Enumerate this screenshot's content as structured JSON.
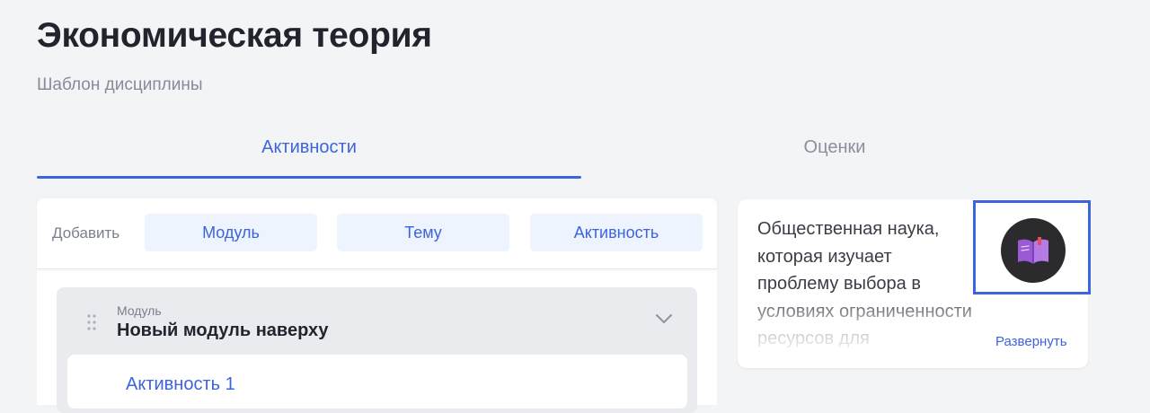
{
  "page": {
    "title": "Экономическая теория",
    "subtitle": "Шаблон дисциплины"
  },
  "tabs": [
    {
      "label": "Активности",
      "active": true
    },
    {
      "label": "Оценки",
      "active": false
    }
  ],
  "add_bar": {
    "label": "Добавить",
    "buttons": [
      "Модуль",
      "Тему",
      "Активность"
    ]
  },
  "module": {
    "type_label": "Модуль",
    "name": "Новый модуль наверху",
    "activities": [
      "Активность 1"
    ]
  },
  "description": {
    "text": "Общественная наука,\nкоторая изучает\nпроблему выбора в\nусловиях ограниченности\nресурсов для",
    "expand_label": "Развернуть",
    "icon": "open-book-icon"
  },
  "colors": {
    "accent": "#3d63dd",
    "background": "#f3f4f6",
    "button_bg": "#eef4fd",
    "module_bg": "#e9ebef",
    "icon_bg": "#2b2b2d",
    "book": "#9b59d6"
  }
}
